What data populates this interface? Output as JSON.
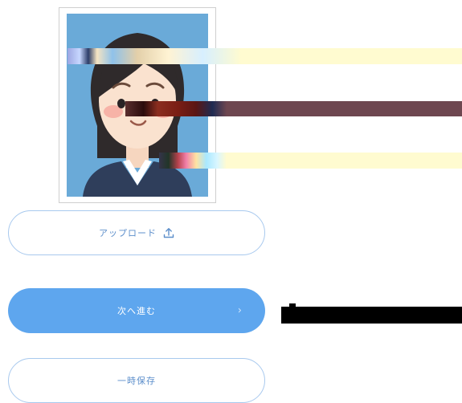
{
  "upload_button": {
    "label": "アップロード",
    "icon": "upload-icon"
  },
  "next_button": {
    "label": "次へ進む",
    "icon": "chevron-right-icon",
    "chevron": "›"
  },
  "save_button": {
    "label": "一時保存"
  },
  "photo": {
    "icon": "profile-photo",
    "background": "#6aaad8"
  },
  "colors": {
    "accent": "#5ea6ee",
    "outline": "#a8c9ee",
    "outline_text": "#5d8fcb"
  }
}
